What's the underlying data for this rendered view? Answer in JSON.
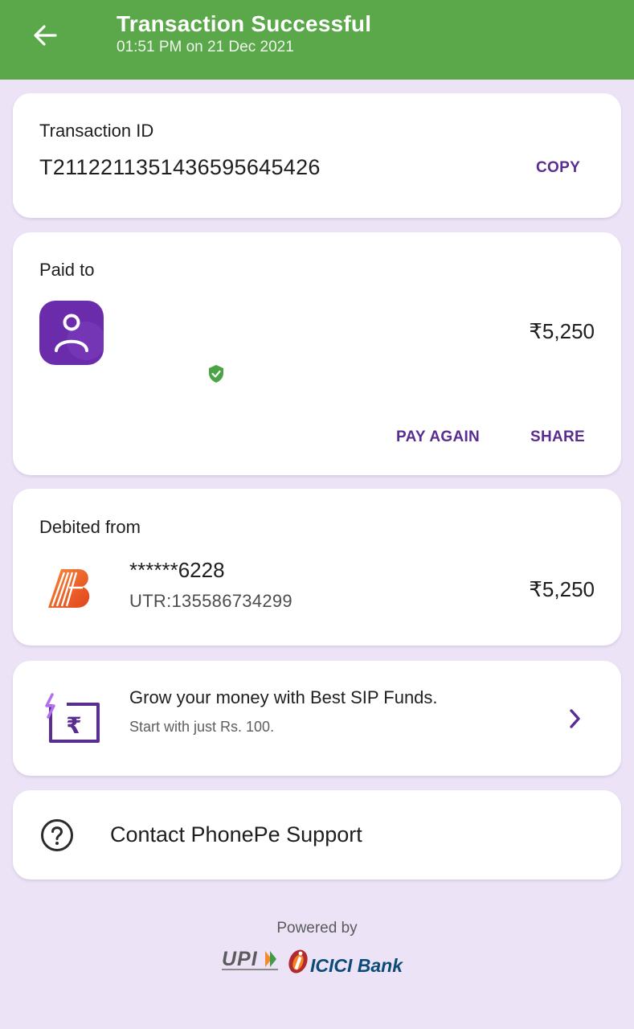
{
  "header": {
    "title": "Transaction Successful",
    "subtitle": "01:51 PM on 21 Dec 2021",
    "back_icon": "arrow-left-icon",
    "bg_color": "#5aa84a"
  },
  "transaction": {
    "label": "Transaction ID",
    "id": "T2112211351436595645426",
    "copy_label": "COPY"
  },
  "paid_to": {
    "label": "Paid to",
    "amount": "₹5,250",
    "avatar_icon": "user-avatar-icon",
    "verified_icon": "verified-shield-icon",
    "pay_again_label": "PAY AGAIN",
    "share_label": "SHARE"
  },
  "debited_from": {
    "label": "Debited from",
    "account": "******6228",
    "utr": "UTR:135586734299",
    "amount": "₹5,250",
    "bank_icon": "bank-of-baroda-logo"
  },
  "promo": {
    "title": "Grow your money with Best SIP Funds.",
    "subtitle": "Start with just Rs. 100.",
    "icon": "sip-rupee-icon",
    "chevron_icon": "chevron-right-icon"
  },
  "support": {
    "label": "Contact PhonePe Support",
    "icon": "help-circle-icon"
  },
  "footer": {
    "powered_by": "Powered by",
    "upi_logo": "UPI",
    "bank_logo": "ICICI Bank"
  },
  "colors": {
    "accent": "#5a2d91",
    "background": "#ece3f6",
    "success": "#5aa84a"
  }
}
